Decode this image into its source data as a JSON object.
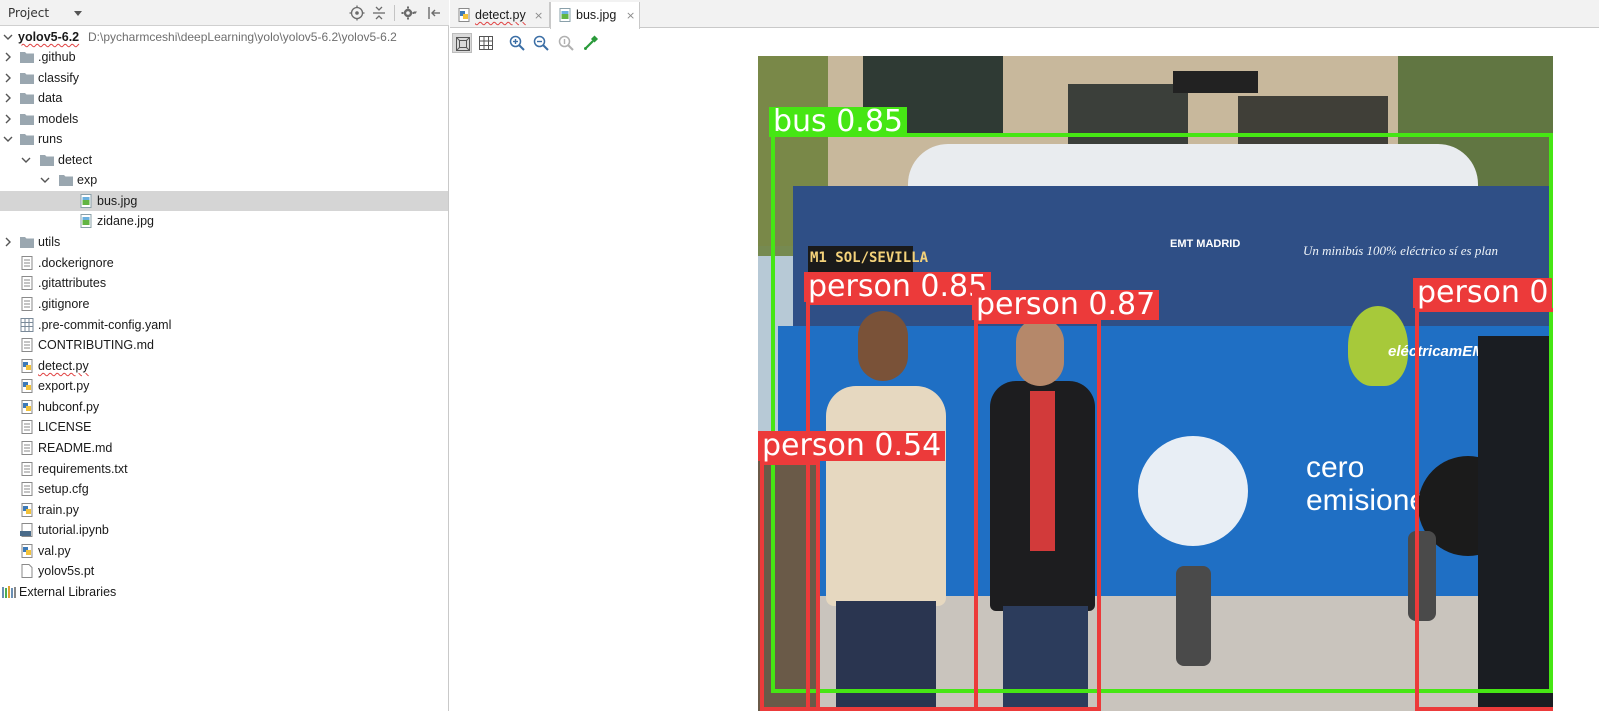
{
  "project_panel": {
    "view_selector": "Project",
    "icons": [
      "target-icon",
      "collapse-all-icon",
      "settings-gear-icon",
      "hide-panel-icon"
    ]
  },
  "tree": {
    "root": {
      "name": "yolov5-6.2",
      "path": "D:\\pycharmceshi\\deepLearning\\yolo\\yolov5-6.2\\yolov5-6.2"
    },
    "items": [
      {
        "name": ".github"
      },
      {
        "name": "classify"
      },
      {
        "name": "data"
      },
      {
        "name": "models"
      },
      {
        "name": "runs"
      },
      {
        "name": "detect"
      },
      {
        "name": "exp"
      },
      {
        "name": "bus.jpg"
      },
      {
        "name": "zidane.jpg"
      },
      {
        "name": "utils"
      },
      {
        "name": ".dockerignore"
      },
      {
        "name": ".gitattributes"
      },
      {
        "name": ".gitignore"
      },
      {
        "name": ".pre-commit-config.yaml"
      },
      {
        "name": "CONTRIBUTING.md"
      },
      {
        "name": "detect.py"
      },
      {
        "name": "export.py"
      },
      {
        "name": "hubconf.py"
      },
      {
        "name": "LICENSE"
      },
      {
        "name": "README.md"
      },
      {
        "name": "requirements.txt"
      },
      {
        "name": "setup.cfg"
      },
      {
        "name": "train.py"
      },
      {
        "name": "tutorial.ipynb"
      },
      {
        "name": "val.py"
      },
      {
        "name": "yolov5s.pt"
      },
      {
        "name": "External Libraries"
      }
    ]
  },
  "tabs": [
    {
      "label": "detect.py",
      "close": "×"
    },
    {
      "label": "bus.jpg",
      "close": "×"
    }
  ],
  "image_toolbar": {
    "buttons": [
      "fit-zoom-icon",
      "grid-icon",
      "zoom-in-icon",
      "zoom-out-icon",
      "actual-size-icon",
      "color-picker-icon"
    ]
  },
  "detections": [
    {
      "label": "bus 0.85",
      "class": "bus",
      "confidence": 0.85,
      "color": "#46e614"
    },
    {
      "label": "person 0.85",
      "class": "person",
      "confidence": 0.85,
      "color": "#ec3a3a"
    },
    {
      "label": "person 0.87",
      "class": "person",
      "confidence": 0.87,
      "color": "#ec3a3a"
    },
    {
      "label": "person 0",
      "class": "person",
      "confidence": null,
      "color": "#ec3a3a"
    },
    {
      "label": "person 0.54",
      "class": "person",
      "confidence": 0.54,
      "color": "#ec3a3a"
    }
  ],
  "bus_signage": {
    "destination": "M1 SOL/SEVILLA",
    "operator": "EMT MADRID",
    "slogan": "Un minibús 100% eléctrico sí es plan",
    "brand": "eléctricamEMTe",
    "side_text_1": "cero",
    "side_text_2": "emisiones"
  },
  "colors": {
    "selected_row": "#d5d5d5",
    "panel_header": "#f2f2f2",
    "bus_box": "#46e614",
    "person_box": "#ec3a3a"
  }
}
